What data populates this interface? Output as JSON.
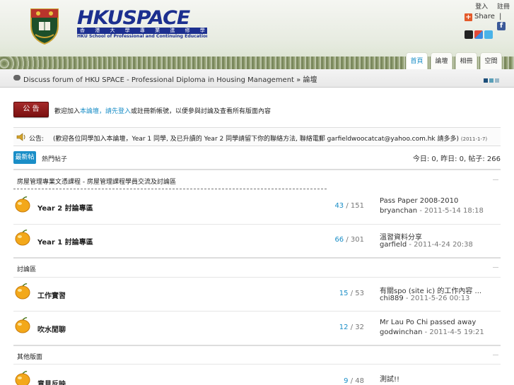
{
  "header": {
    "top_links": [
      "登入",
      "註冊"
    ],
    "logo_word": "HKUSPACE",
    "logo_cn": "香 港 大 學 專 業 進 修 學 院",
    "logo_en": "HKU School of Professional and Continuing Education",
    "share_label": "Share",
    "share_sep": "|",
    "fb_glyph": "f",
    "tabs": [
      "首頁",
      "論壇",
      "相冊",
      "空間"
    ]
  },
  "breadcrumb": {
    "text": "Discuss forum of HKU SPACE - Professional Diploma in Housing Management » 論壇"
  },
  "notice": {
    "button": "公 告",
    "text_a": "歡迎加入",
    "text_b": "本論壇，請先",
    "text_c": "登入",
    "text_d": "或註冊新帳號，以便參與討論及查看所有版面內容"
  },
  "announcement": {
    "label": "公告:",
    "text": "(歡迎各位同學加入本論壇，Year 1 同學, 及已升讀的 Year 2 同學請留下你的聯絡方法, 聯絡電郵 garfieldwoocatcat@yahoo.com.hk 請多多)",
    "date": "(2011-1-7)"
  },
  "toolbar": {
    "primary": "最新帖子",
    "secondary": "熱門帖子",
    "stats": "今日: 0, 昨日: 0, 帖子: 266"
  },
  "categories": [
    {
      "title": "房屋管理專業文憑課程 - 房屋管理課程學員交流及討論區"
    },
    {
      "title": "討論區"
    },
    {
      "title": "其他版面"
    }
  ],
  "forums": [
    {
      "name": "Year 2 討論專區",
      "threads": "43",
      "posts": "151",
      "last_title": "Pass Paper 2008-2010",
      "last_user": "bryanchan",
      "last_time": "2011-5-14 18:18"
    },
    {
      "name": "Year 1 討論專區",
      "threads": "66",
      "posts": "301",
      "last_title": "溫習資料分享",
      "last_user": "garfield",
      "last_time": "2011-4-24 20:38"
    },
    {
      "name": "工作實習",
      "threads": "15",
      "posts": "53",
      "last_title": "有關spo (site ic) 的工作內容 ...",
      "last_user": "chi889",
      "last_time": "2011-5-26 00:13"
    },
    {
      "name": "吹水閒聊",
      "threads": "12",
      "posts": "32",
      "last_title": "Mr Lau Po Chi passed away",
      "last_user": "godwinchan",
      "last_time": "2011-4-5 19:21"
    },
    {
      "name": "意見反映",
      "threads": "9",
      "posts": "48",
      "last_title": "測試!!",
      "last_user": "",
      "last_time": ""
    }
  ],
  "colors": {
    "accent": "#1a8ec7",
    "notice_red": "#8b1a1a",
    "logo_blue": "#1c2f8f"
  }
}
